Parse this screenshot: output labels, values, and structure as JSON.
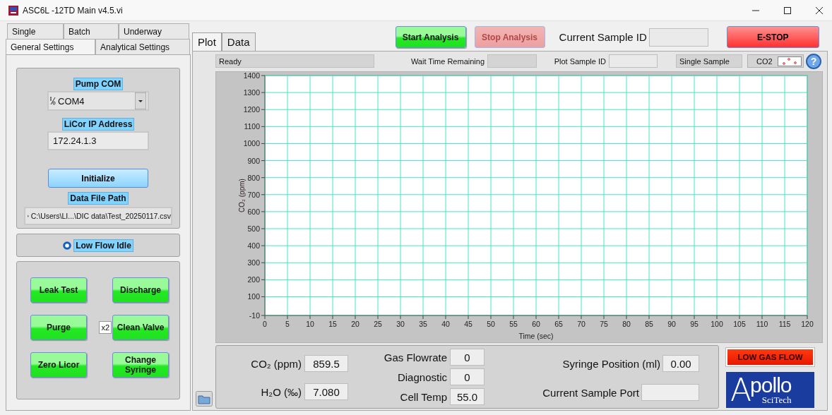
{
  "window": {
    "title": "ASC6L -12TD Main v4.5.vi"
  },
  "left_tabs_back": [
    {
      "label": "Single",
      "selected": false
    },
    {
      "label": "Batch",
      "selected": false
    },
    {
      "label": "Underway",
      "selected": false
    }
  ],
  "left_tabs_front": [
    {
      "label": "General Settings",
      "selected": true
    },
    {
      "label": "Analytical Settings",
      "selected": false
    }
  ],
  "general_settings": {
    "pump_com": {
      "label": "Pump COM",
      "value": "COM4"
    },
    "licor_ip": {
      "label": "LiCor IP Address",
      "value": "172.24.1.3"
    },
    "initialize_button": "Initialize",
    "data_file_path": {
      "label": "Data File Path",
      "value": "C:\\Users\\LI...\\DIC data\\Test_20250117.csv"
    }
  },
  "low_flow_idle": {
    "label": "Low Flow Idle",
    "on": true
  },
  "action_buttons": [
    {
      "label": "Leak Test"
    },
    {
      "label": "Discharge"
    },
    {
      "label": "Purge"
    },
    {
      "label": "Clean Valve",
      "multiplier": "x2"
    },
    {
      "label": "Zero Licor"
    },
    {
      "label": "Change Syringe"
    }
  ],
  "plot_tabs": [
    {
      "label": "Plot",
      "selected": true
    },
    {
      "label": "Data",
      "selected": false
    }
  ],
  "analysis_buttons": [
    {
      "label": "Start Analysis",
      "disabled": false
    },
    {
      "label": "Stop Analysis",
      "disabled": true
    }
  ],
  "current_sample_id": {
    "label": "Current Sample ID"
  },
  "estop_button": "E-STOP",
  "status": {
    "message": "Ready",
    "wait_label": "Wait Time Remaining",
    "plot_sample_label": "Plot Sample ID",
    "mode": "Single Sample",
    "channel": "CO2",
    "help": "?"
  },
  "chart": {
    "chart_data": {
      "type": "line",
      "grid": true,
      "xlabel": "Time (sec)",
      "ylabel": "CO₂ (ppm)",
      "xlim": [
        0,
        120
      ],
      "ylim": [
        -10,
        1400
      ],
      "xticks": [
        0,
        5,
        10,
        15,
        20,
        25,
        30,
        35,
        40,
        45,
        50,
        55,
        60,
        65,
        70,
        75,
        80,
        85,
        90,
        95,
        100,
        105,
        110,
        115,
        120
      ],
      "yticks": [
        -10,
        100,
        200,
        300,
        400,
        500,
        600,
        700,
        800,
        900,
        1000,
        1100,
        1200,
        1300,
        1400
      ]
    }
  },
  "readings": [
    {
      "label": "CO₂ (ppm)",
      "value": "859.5"
    },
    {
      "label": "H₂O (‰)",
      "value": "7.080"
    }
  ],
  "diagnostics": [
    {
      "label": "Gas Flowrate",
      "value": "0"
    },
    {
      "label": "Diagnostic",
      "value": "0"
    },
    {
      "label": "Cell Temp",
      "value": "55.0"
    }
  ],
  "syringe": [
    {
      "label": "Syringe Position (ml)",
      "value": "0.00"
    },
    {
      "label": "Current Sample Port"
    }
  ],
  "alarm": {
    "label": "LOW GAS FLOW",
    "on": true
  },
  "logo": {
    "initial": "A",
    "name": "pollo",
    "tagline": "SciTech"
  }
}
